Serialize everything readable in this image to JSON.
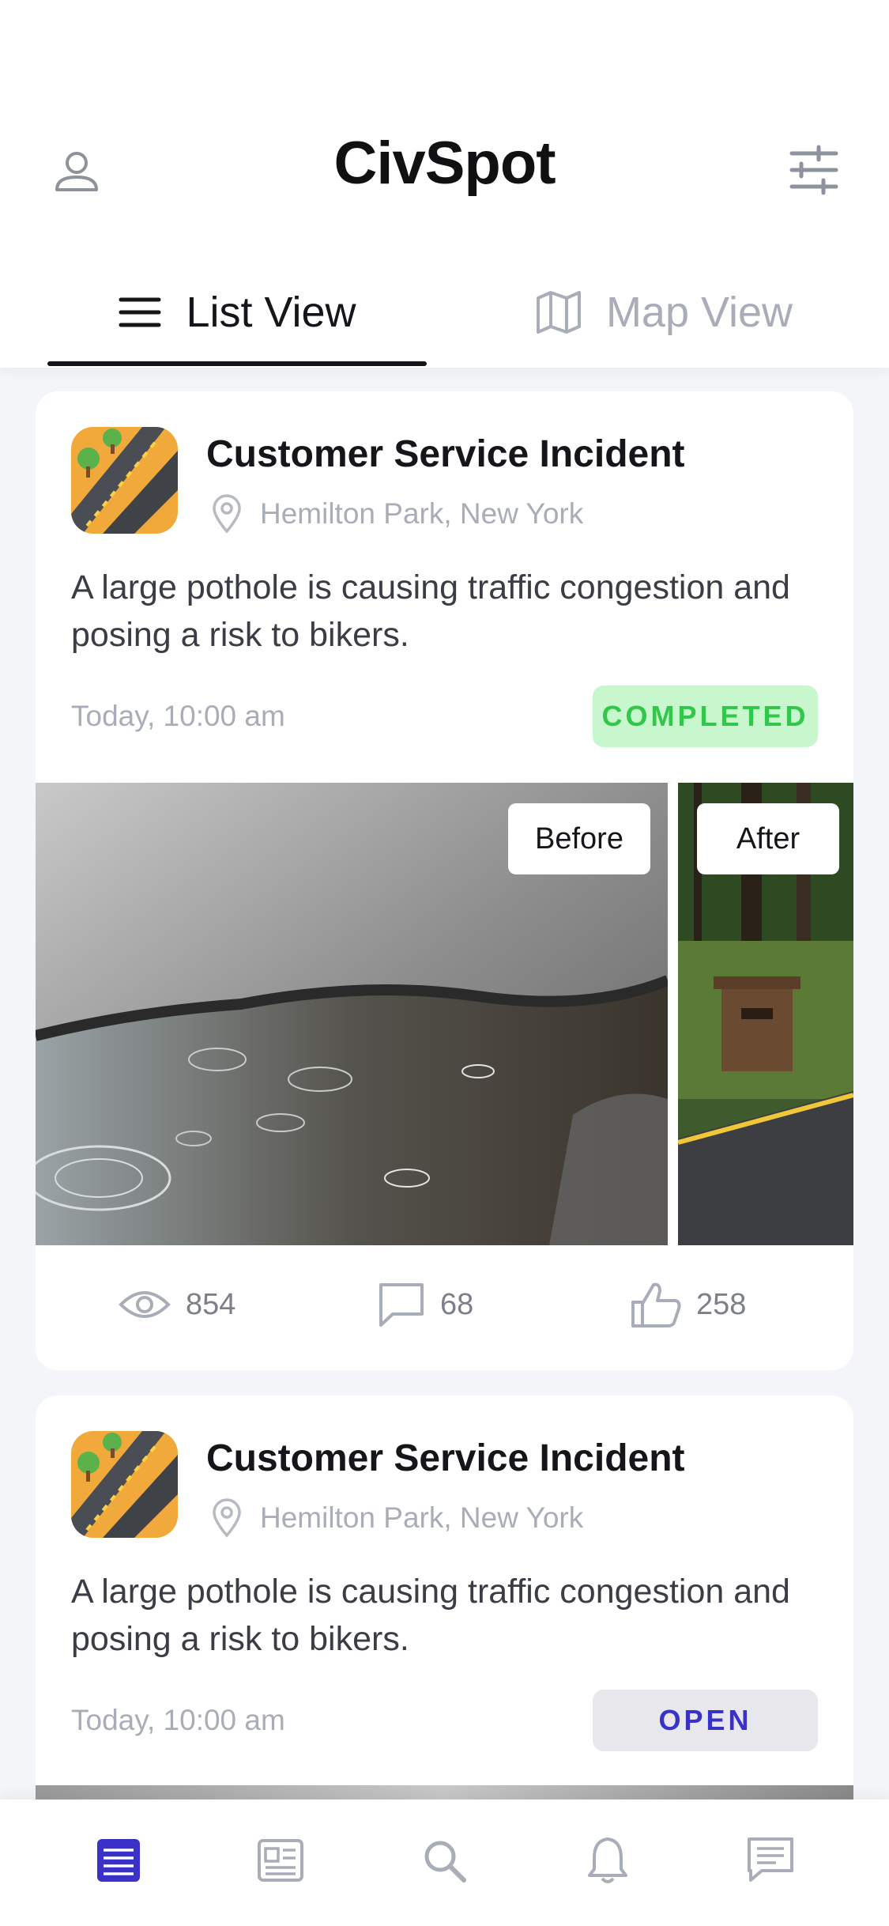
{
  "app": {
    "title": "CivSpot"
  },
  "tabs": [
    {
      "label": "List View",
      "active": true,
      "icon": "menu-icon"
    },
    {
      "label": "Map View",
      "active": false,
      "icon": "map-icon"
    }
  ],
  "colors": {
    "accent": "#3a31c9",
    "completed_bg": "#c8f6cd",
    "completed_text": "#32c74a",
    "open_bg": "#e7e7ec",
    "muted": "#a9adb7"
  },
  "reports": [
    {
      "title": "Customer Service Incident",
      "location": "Hemilton Park, New York",
      "description": "A large pothole is causing traffic congestion and posing a risk to bikers.",
      "time": "Today, 10:00 am",
      "status": "COMPLETED",
      "photos": {
        "before_label": "Before",
        "after_label": "After"
      },
      "stats": {
        "views": "854",
        "comments": "68",
        "likes": "258"
      }
    },
    {
      "title": "Customer Service Incident",
      "location": "Hemilton Park, New York",
      "description": "A large pothole is causing traffic congestion and posing a risk to bikers.",
      "time": "Today, 10:00 am",
      "status": "OPEN"
    }
  ],
  "bottom_nav": [
    {
      "icon": "feed-icon",
      "active": true
    },
    {
      "icon": "news-icon",
      "active": false
    },
    {
      "icon": "search-icon",
      "active": false
    },
    {
      "icon": "bell-icon",
      "active": false
    },
    {
      "icon": "chat-icon",
      "active": false
    }
  ]
}
